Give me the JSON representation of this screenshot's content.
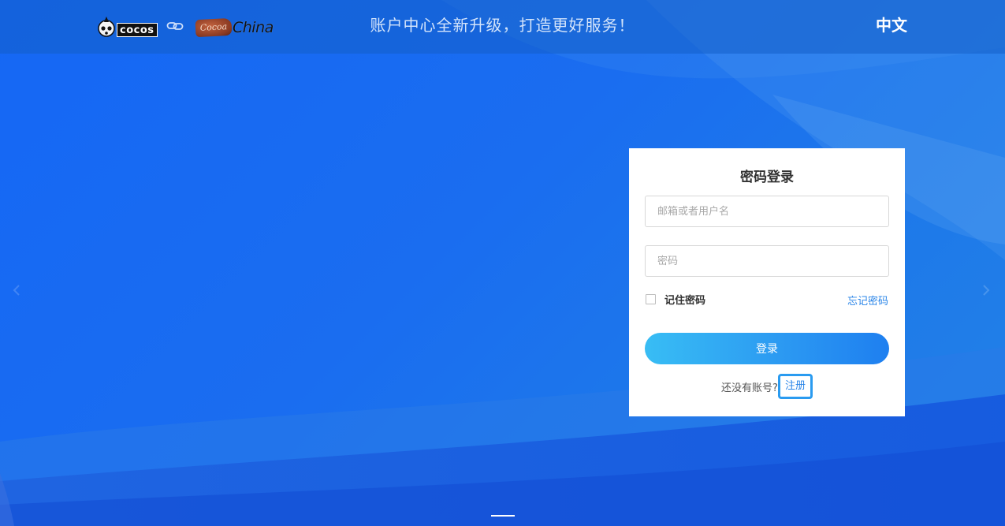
{
  "header": {
    "brand_logo": "cocos",
    "link_icon": "link-icon",
    "partner_logo_badge": "Cocoa",
    "partner_logo_text": "China",
    "slogan": "账户中心全新升级，打造更好服务！",
    "language": "中文"
  },
  "login": {
    "title": "密码登录",
    "username_placeholder": "邮箱或者用户名",
    "username_value": "",
    "password_placeholder": "密码",
    "password_value": "",
    "remember_label": "记住密码",
    "remember_checked": false,
    "forgot_label": "忘记密码",
    "submit_label": "登录",
    "no_account_text": "还没有账号?",
    "signup_label": "注册"
  },
  "colors": {
    "accent": "#2a85e8",
    "button_start": "#38bdf4",
    "button_end": "#1e7ff0",
    "background": "#1567f5"
  },
  "carousel": {
    "prev_icon": "chevron-left-icon",
    "next_icon": "chevron-right-icon",
    "active_index": 1,
    "total": 1
  }
}
